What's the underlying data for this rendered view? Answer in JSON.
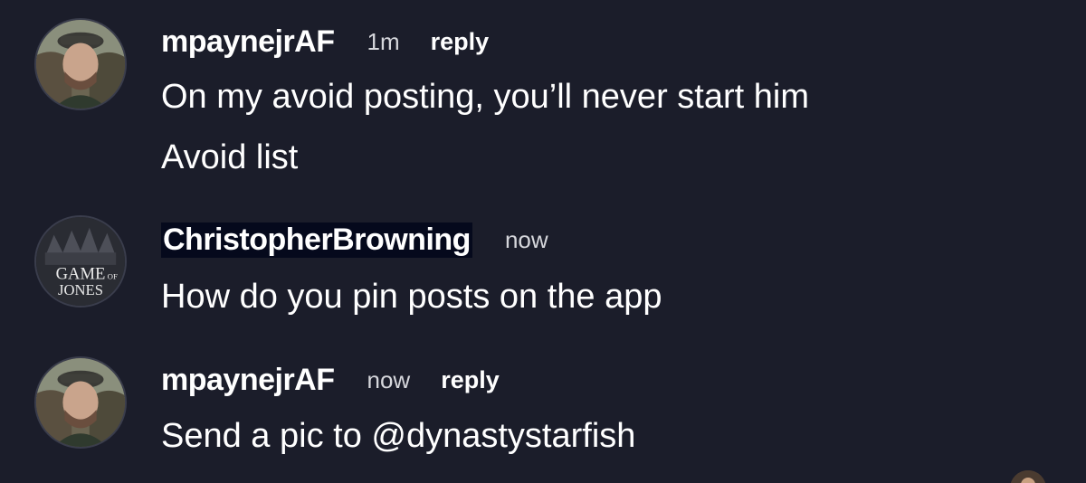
{
  "messages": [
    {
      "username": "mpaynejrAF",
      "time": "1m",
      "reply_label": "reply",
      "lines": [
        "On my avoid posting, you’ll never start him",
        "Avoid list"
      ]
    },
    {
      "username": "ChristopherBrowning",
      "time": "now",
      "lines": [
        "How do you pin posts on the app"
      ],
      "avatar_text": [
        "GAME",
        "OF",
        "JONES"
      ]
    },
    {
      "username": "mpaynejrAF",
      "time": "now",
      "reply_label": "reply",
      "lines": [
        "Send a pic to @dynastystarfish"
      ]
    }
  ],
  "colors": {
    "background": "#1b1d2a",
    "text": "#ffffff",
    "muted": "#d6d7dc",
    "highlight": "#05091c"
  }
}
